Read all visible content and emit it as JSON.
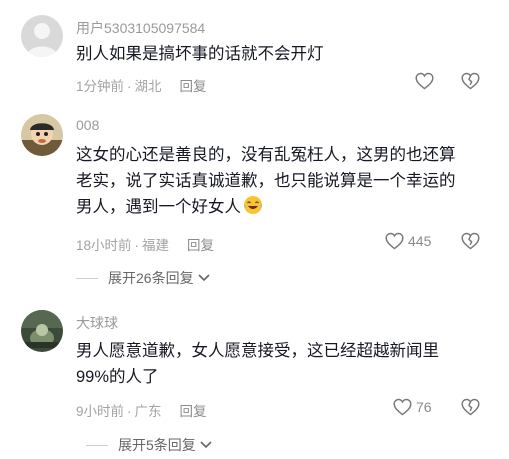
{
  "comments": [
    {
      "username": "用户5303105097584",
      "text": "别人如果是搞坏事的话就不会开灯",
      "time": "1分钟前",
      "location": "湖北",
      "reply_label": "回复",
      "likes": ""
    },
    {
      "username": "008",
      "text_lines": [
        "这女的心还是善良的，没有乱冤枉人，这男的也还算",
        "老实，说了实话真诚道歉，也只能说算是一个幸运的",
        "男人，遇到一个好女人"
      ],
      "emoji": "laughing-crying-emoji",
      "time": "18小时前",
      "location": "福建",
      "reply_label": "回复",
      "likes": "445",
      "expand_label": "展开26条回复"
    },
    {
      "username": "大球球",
      "text_lines": [
        "男人愿意道歉，女人愿意接受，这已经超越新闻里",
        "99%的人了"
      ],
      "time": "9小时前",
      "location": "广东",
      "reply_label": "回复",
      "likes": "76",
      "expand_label": "展开5条回复"
    }
  ],
  "separator": "·",
  "colors": {
    "text": "#161823",
    "meta": "#a3a3a3",
    "username": "#9a9a9a"
  }
}
